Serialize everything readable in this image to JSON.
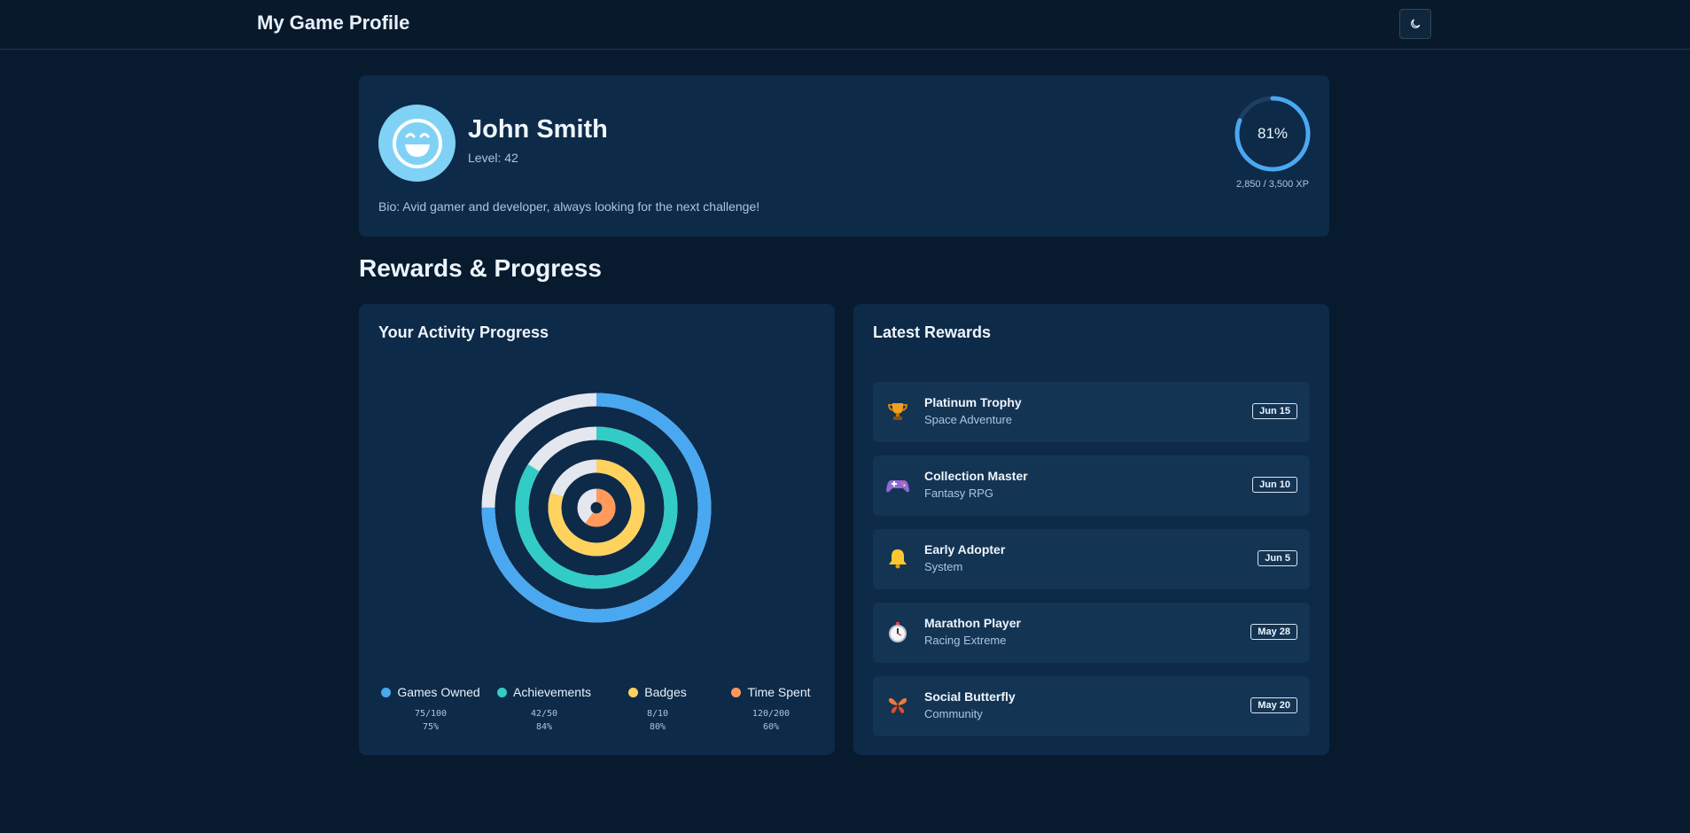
{
  "header": {
    "title": "My Game Profile",
    "theme_icon": "moon-icon"
  },
  "profile": {
    "name": "John Smith",
    "level": "Level: 42",
    "bio": "Bio: Avid gamer and developer, always looking for the next challenge!",
    "xp_percent_label": "81%",
    "xp_progress": 0.81,
    "xp_text": "2,850 / 3,500 XP",
    "avatar_color": "#7fd2f6"
  },
  "section_title": "Rewards & Progress",
  "activity": {
    "title": "Your Activity Progress",
    "chart_data": {
      "type": "pie",
      "series": [
        {
          "name": "Games Owned",
          "value": 75,
          "total": 100,
          "fraction": "75/100",
          "percent": "75%",
          "color": "#4aa8f0"
        },
        {
          "name": "Achievements",
          "value": 42,
          "total": 50,
          "fraction": "42/50",
          "percent": "84%",
          "color": "#33cbc6"
        },
        {
          "name": "Badges",
          "value": 8,
          "total": 10,
          "fraction": "8/10",
          "percent": "80%",
          "color": "#ffd25e"
        },
        {
          "name": "Time Spent",
          "value": 120,
          "total": 200,
          "fraction": "120/200",
          "percent": "60%",
          "color": "#ff9a5a"
        }
      ],
      "remainder_color": "#e4e7ee"
    }
  },
  "rewards": {
    "title": "Latest Rewards",
    "items": [
      {
        "icon": "trophy-icon",
        "name": "Platinum Trophy",
        "game": "Space Adventure",
        "date": "Jun 15"
      },
      {
        "icon": "gamepad-icon",
        "name": "Collection Master",
        "game": "Fantasy RPG",
        "date": "Jun 10"
      },
      {
        "icon": "bell-icon",
        "name": "Early Adopter",
        "game": "System",
        "date": "Jun 5"
      },
      {
        "icon": "stopwatch-icon",
        "name": "Marathon Player",
        "game": "Racing Extreme",
        "date": "May 28"
      },
      {
        "icon": "butterfly-icon",
        "name": "Social Butterfly",
        "game": "Community",
        "date": "May 20"
      }
    ]
  }
}
